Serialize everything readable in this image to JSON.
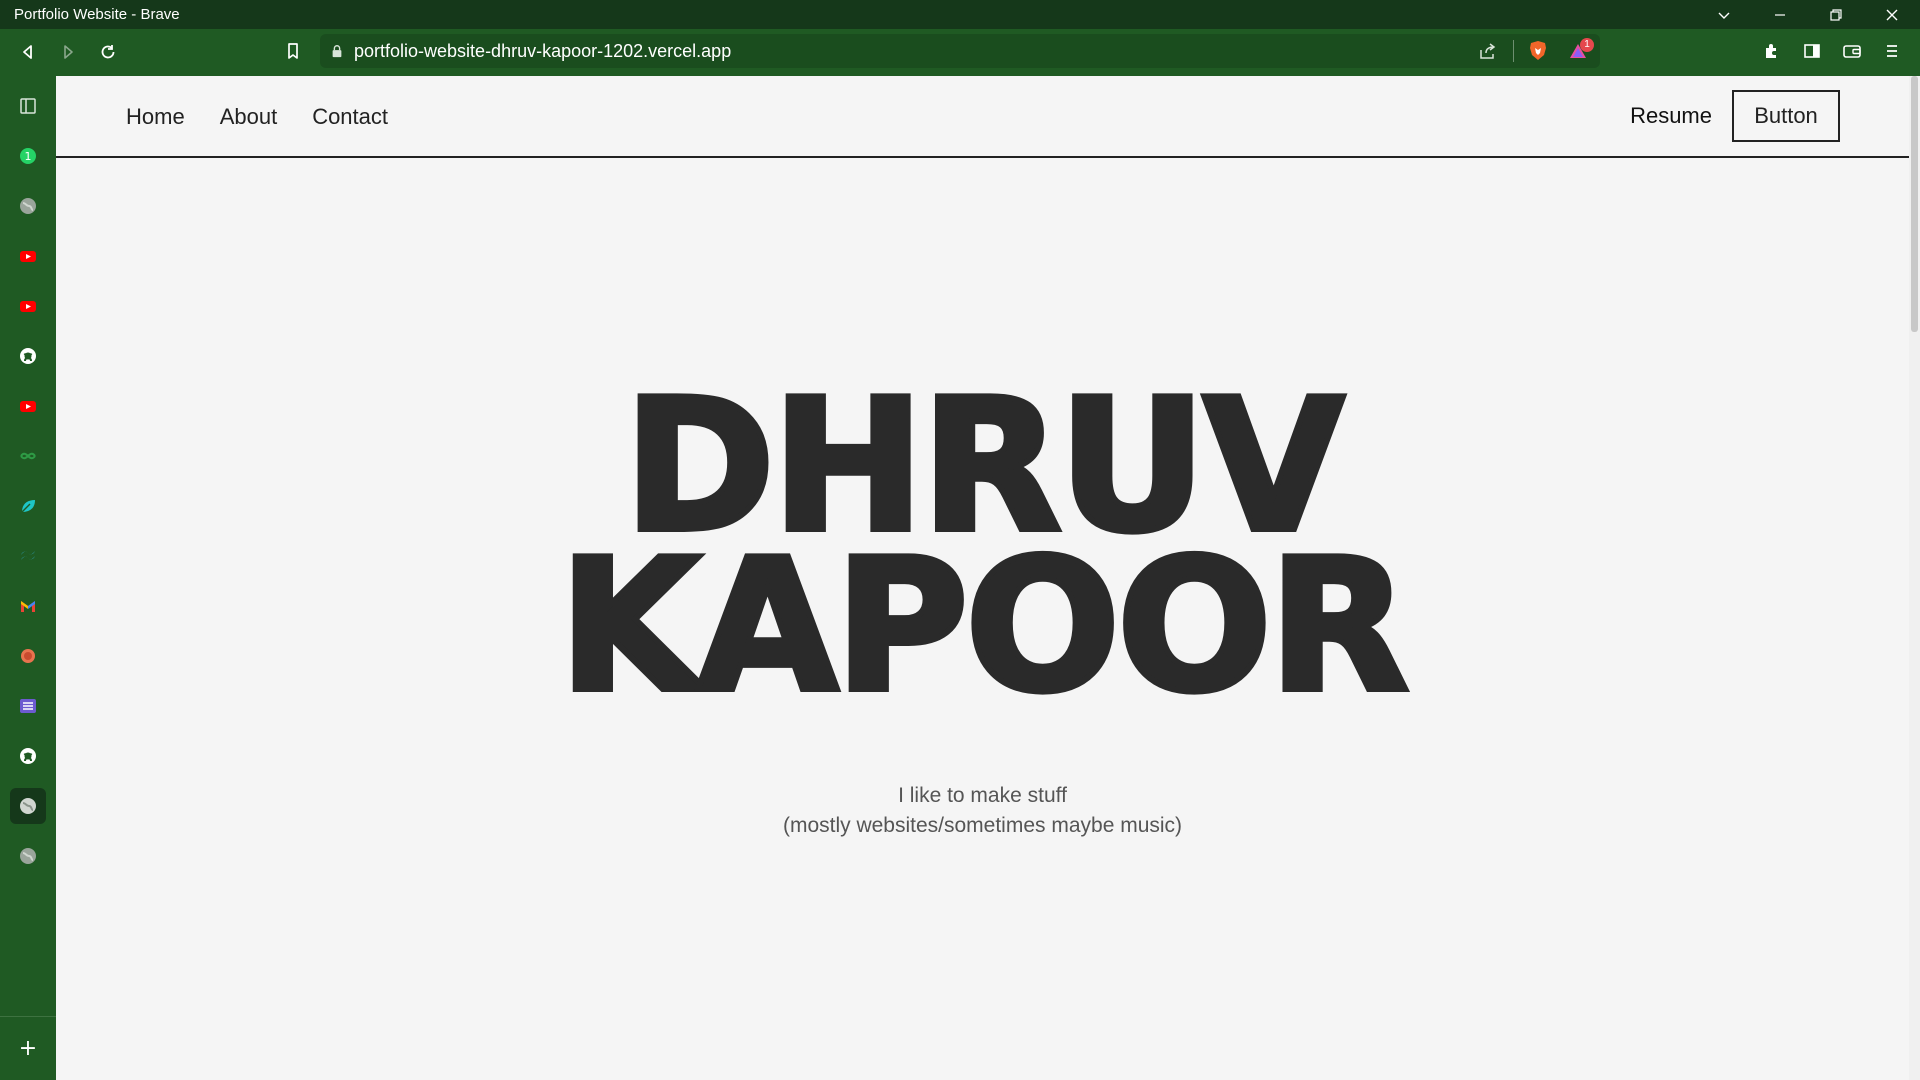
{
  "window": {
    "title": "Portfolio Website - Brave"
  },
  "browser": {
    "url": "portfolio-website-dhruv-kapoor-1202.vercel.app",
    "rewards_badge": "1"
  },
  "sidebar": {
    "items": [
      {
        "name": "sidebar-panel-icon"
      },
      {
        "name": "whatsapp-icon"
      },
      {
        "name": "globe-icon"
      },
      {
        "name": "youtube-icon"
      },
      {
        "name": "youtube-icon"
      },
      {
        "name": "github-icon"
      },
      {
        "name": "youtube-icon"
      },
      {
        "name": "green-app-icon"
      },
      {
        "name": "leaf-icon"
      },
      {
        "name": "tailwind-icon"
      },
      {
        "name": "gmail-icon"
      },
      {
        "name": "red-circle-icon"
      },
      {
        "name": "list-app-icon"
      },
      {
        "name": "github-icon"
      },
      {
        "name": "globe-icon"
      },
      {
        "name": "globe-icon"
      }
    ],
    "add_label": "+"
  },
  "page": {
    "nav": {
      "links": [
        "Home",
        "About",
        "Contact"
      ],
      "resume": "Resume",
      "button": "Button"
    },
    "hero": {
      "first_name": "DHRUV",
      "last_name": "KAPOOR",
      "tagline_1": "I like to make stuff",
      "tagline_2": "(mostly websites/sometimes maybe music)"
    }
  },
  "colors": {
    "browser_green": "#1f5a23",
    "titlebar_green": "#15381a",
    "page_bg": "#f5f5f5",
    "hero_text": "#2a2a2a"
  }
}
